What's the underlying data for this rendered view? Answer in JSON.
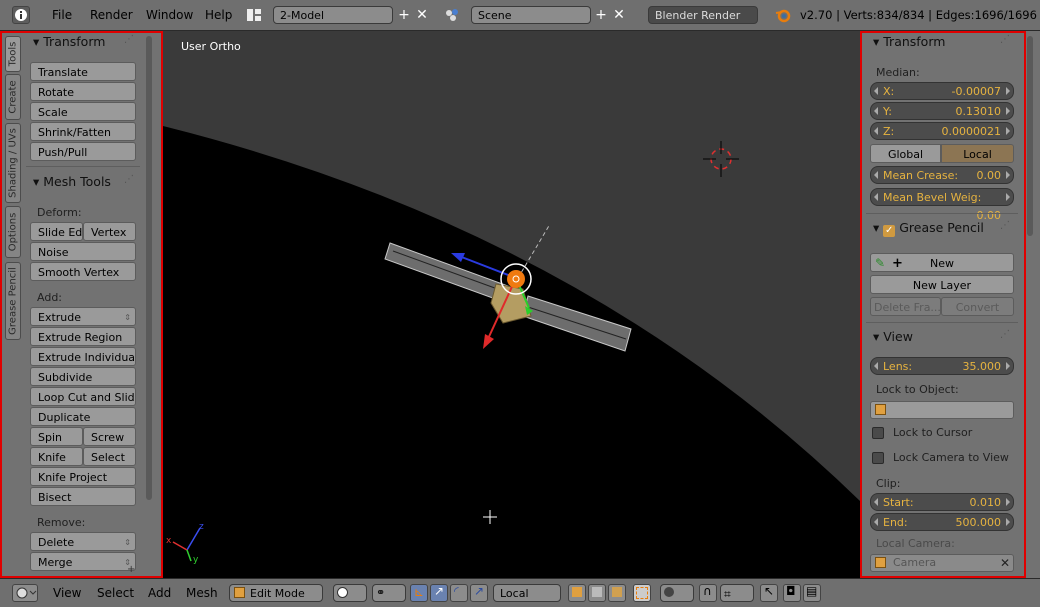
{
  "topbar": {
    "menus": [
      "File",
      "Render",
      "Window",
      "Help"
    ],
    "screen_layout": "2-Model",
    "scene": "Scene",
    "render_engine": "Blender Render",
    "stats": "v2.70 | Verts:834/834 | Edges:1696/1696 | Fac"
  },
  "viewport": {
    "view_label": "User Ortho"
  },
  "left_panel": {
    "tabs": [
      "Tools",
      "Create",
      "Shading / UVs",
      "Options",
      "Grease Pencil"
    ],
    "transform": {
      "title": "Transform",
      "buttons": [
        "Translate",
        "Rotate",
        "Scale",
        "Shrink/Fatten",
        "Push/Pull"
      ]
    },
    "mesh_tools": {
      "title": "Mesh Tools",
      "deform_label": "Deform:",
      "slide_edge": "Slide Ed",
      "vertex": "Vertex",
      "noise": "Noise",
      "smooth_vertex": "Smooth Vertex",
      "add_label": "Add:",
      "extrude": "Extrude",
      "extrude_region": "Extrude Region",
      "extrude_individual": "Extrude Individual",
      "subdivide": "Subdivide",
      "loop_cut": "Loop Cut and Slide",
      "duplicate": "Duplicate",
      "spin": "Spin",
      "screw": "Screw",
      "knife": "Knife",
      "select": "Select",
      "knife_project": "Knife Project",
      "bisect": "Bisect",
      "remove_label": "Remove:",
      "delete": "Delete",
      "merge": "Merge"
    }
  },
  "right_panel": {
    "transform": {
      "title": "Transform",
      "median_label": "Median:",
      "x_label": "X:",
      "x_value": "-0.00007",
      "y_label": "Y:",
      "y_value": "0.13010",
      "z_label": "Z:",
      "z_value": "0.0000021",
      "global": "Global",
      "local": "Local",
      "mean_crease_label": "Mean Crease:",
      "mean_crease_value": "0.00",
      "mean_bevel_label": "Mean Bevel Weig:",
      "mean_bevel_value": "0.00"
    },
    "grease_pencil": {
      "title": "Grease Pencil",
      "new": "New",
      "new_layer": "New Layer",
      "delete_frame": "Delete Fra...",
      "convert": "Convert"
    },
    "view": {
      "title": "View",
      "lens_label": "Lens:",
      "lens_value": "35.000",
      "lock_to_object_label": "Lock to Object:",
      "lock_to_cursor": "Lock to Cursor",
      "lock_camera_to_view": "Lock Camera to View",
      "clip_label": "Clip:",
      "start_label": "Start:",
      "start_value": "0.010",
      "end_label": "End:",
      "end_value": "500.000",
      "local_camera_label": "Local Camera:",
      "camera_placeholder": "Camera"
    }
  },
  "bottombar": {
    "menus": [
      "View",
      "Select",
      "Add",
      "Mesh"
    ],
    "mode": "Edit Mode",
    "orientation": "Local"
  },
  "colors": {
    "highlight_red": "#e00000",
    "value_orange": "#e6b340",
    "active_local": "#8c7553"
  }
}
